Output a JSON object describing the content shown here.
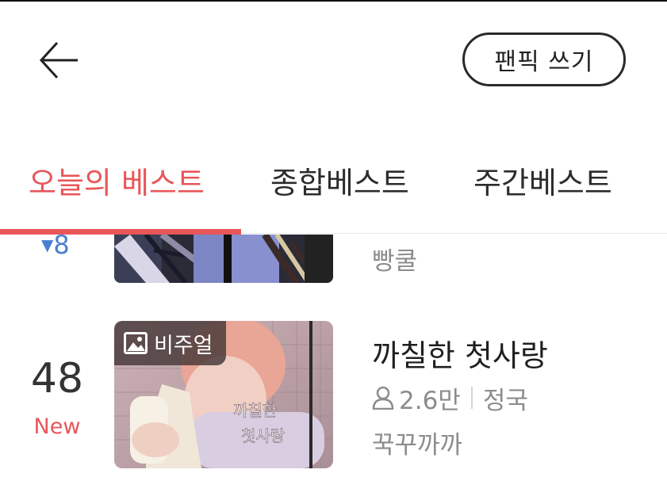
{
  "header": {
    "write_label": "팬픽 쓰기"
  },
  "tabs": [
    {
      "label": "오늘의 베스트",
      "active": true
    },
    {
      "label": "종합베스트",
      "active": false
    },
    {
      "label": "주간베스트",
      "active": false
    }
  ],
  "list": [
    {
      "rank_change": "8",
      "author": "빵쿨"
    },
    {
      "rank": "48",
      "rank_status": "New",
      "badge": "비주얼",
      "thumb_caption": "까칠한\n첫사랑",
      "title": "까칠한 첫사랑",
      "views": "2.6만",
      "tag": "정국",
      "author": "꾹꾸까까"
    }
  ],
  "colors": {
    "accent": "#e8565a",
    "rank_up_down": "#4a7fd1",
    "muted": "#8c8c8c"
  },
  "icons": [
    "back-arrow-icon",
    "image-icon",
    "person-icon"
  ]
}
